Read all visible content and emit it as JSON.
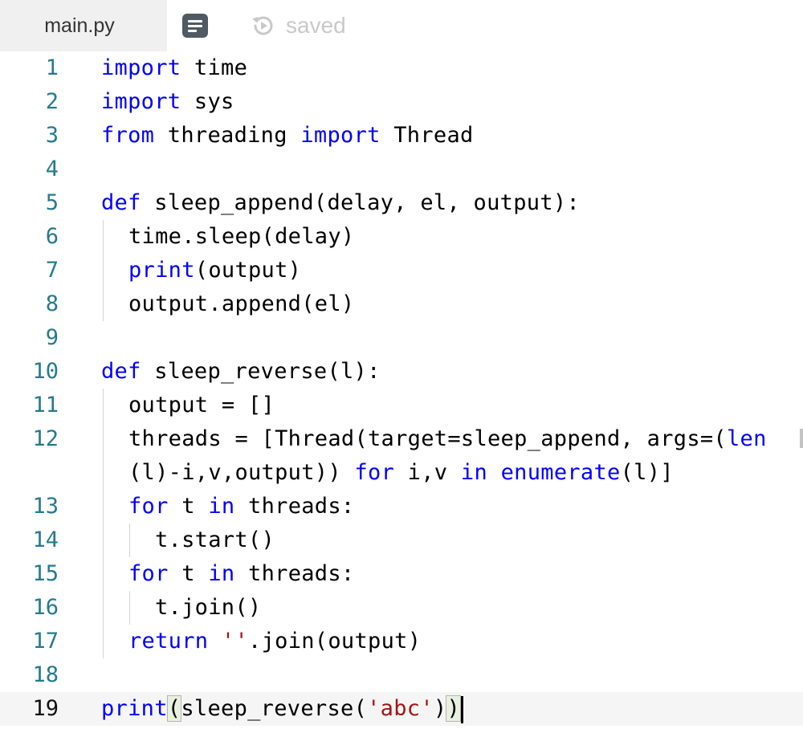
{
  "tab": {
    "filename": "main.py"
  },
  "status": {
    "saved_label": "saved"
  },
  "icons": {
    "doc": "document-icon",
    "saved": "history-icon"
  },
  "colors": {
    "keyword": "#0000ff",
    "string": "#a31515",
    "line_number": "#257a8e",
    "active_line_bg": "#f5f5f5"
  },
  "editor": {
    "language": "python",
    "active_line": "19",
    "lines": [
      {
        "n": "1",
        "tokens": [
          "import",
          " time"
        ]
      },
      {
        "n": "2",
        "tokens": [
          "import",
          " sys"
        ]
      },
      {
        "n": "3",
        "tokens": [
          "from",
          " threading ",
          "import",
          " Thread"
        ]
      },
      {
        "n": "4",
        "tokens": []
      },
      {
        "n": "5",
        "tokens": [
          "def",
          " sleep_append(delay, el, output):"
        ]
      },
      {
        "n": "6",
        "tokens": [
          "time.sleep(delay)"
        ]
      },
      {
        "n": "7",
        "tokens": [
          "print",
          "(output)"
        ]
      },
      {
        "n": "8",
        "tokens": [
          "output.append(el)"
        ]
      },
      {
        "n": "9",
        "tokens": []
      },
      {
        "n": "10",
        "tokens": [
          "def",
          " sleep_reverse(l):"
        ]
      },
      {
        "n": "11",
        "tokens": [
          "output = []"
        ]
      },
      {
        "n": "12",
        "tokens": [
          "threads = [Thread(target=sleep_append, args=(",
          "len"
        ],
        "wrap_tokens": [
          "(l)-i,v,output)) ",
          "for",
          " i,v ",
          "in",
          " ",
          "enumerate",
          "(l)]"
        ]
      },
      {
        "n": "13",
        "tokens": [
          "for",
          " t ",
          "in",
          " threads:"
        ]
      },
      {
        "n": "14",
        "tokens": [
          "t.start()"
        ]
      },
      {
        "n": "15",
        "tokens": [
          "for",
          " t ",
          "in",
          " threads:"
        ]
      },
      {
        "n": "16",
        "tokens": [
          "t.join()"
        ]
      },
      {
        "n": "17",
        "tokens": [
          "return",
          " ",
          "''",
          ".join(output)"
        ]
      },
      {
        "n": "18",
        "tokens": []
      },
      {
        "n": "19",
        "tokens": [
          "print",
          "(",
          "sleep_reverse(",
          "'abc'",
          ")",
          ")"
        ]
      }
    ]
  }
}
